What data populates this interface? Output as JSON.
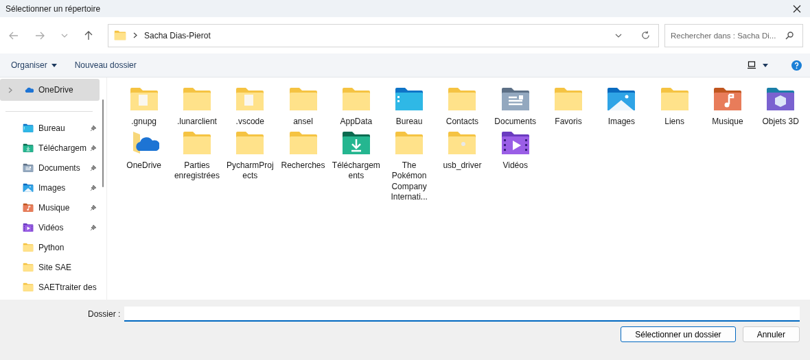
{
  "window": {
    "title": "Sélectionner un répertoire"
  },
  "address_bar": {
    "path": [
      "Sacha Dias-Pierot"
    ]
  },
  "search": {
    "placeholder": "Rechercher dans : Sacha Di..."
  },
  "toolbar": {
    "organize": "Organiser",
    "new_folder": "Nouveau dossier"
  },
  "sidebar": {
    "items": [
      {
        "label": "OneDrive",
        "kind": "onedrive",
        "selected": true,
        "pinned": false,
        "expandable": true
      },
      {
        "label": "Bureau",
        "kind": "desktop",
        "selected": false,
        "pinned": true,
        "expandable": false
      },
      {
        "label": "Téléchargem",
        "kind": "download",
        "selected": false,
        "pinned": true,
        "expandable": false
      },
      {
        "label": "Documents",
        "kind": "documents",
        "selected": false,
        "pinned": true,
        "expandable": false
      },
      {
        "label": "Images",
        "kind": "images",
        "selected": false,
        "pinned": true,
        "expandable": false
      },
      {
        "label": "Musique",
        "kind": "music",
        "selected": false,
        "pinned": true,
        "expandable": false
      },
      {
        "label": "Vidéos",
        "kind": "videos",
        "selected": false,
        "pinned": true,
        "expandable": false
      },
      {
        "label": "Python",
        "kind": "folder",
        "selected": false,
        "pinned": false,
        "expandable": false
      },
      {
        "label": "Site SAE",
        "kind": "folder",
        "selected": false,
        "pinned": false,
        "expandable": false
      },
      {
        "label": "SAETtraiter des",
        "kind": "folder",
        "selected": false,
        "pinned": false,
        "expandable": false
      }
    ]
  },
  "folders": [
    {
      "name": ".gnupg",
      "kind": "files"
    },
    {
      "name": ".lunarclient",
      "kind": "folder"
    },
    {
      "name": ".vscode",
      "kind": "files"
    },
    {
      "name": "ansel",
      "kind": "folder"
    },
    {
      "name": "AppData",
      "kind": "folder"
    },
    {
      "name": "Bureau",
      "kind": "desktop"
    },
    {
      "name": "Contacts",
      "kind": "folder"
    },
    {
      "name": "Documents",
      "kind": "documents"
    },
    {
      "name": "Favoris",
      "kind": "folder"
    },
    {
      "name": "Images",
      "kind": "images"
    },
    {
      "name": "Liens",
      "kind": "folder"
    },
    {
      "name": "Musique",
      "kind": "music"
    },
    {
      "name": "Objets 3D",
      "kind": "objects3d"
    },
    {
      "name": "OneDrive",
      "kind": "onedrive"
    },
    {
      "name": "Parties enregistrées",
      "kind": "folder"
    },
    {
      "name": "PycharmProjects",
      "kind": "folder"
    },
    {
      "name": "Recherches",
      "kind": "folder"
    },
    {
      "name": "Téléchargements",
      "kind": "download"
    },
    {
      "name": "The Pokémon Company Internati...",
      "kind": "folder"
    },
    {
      "name": "usb_driver",
      "kind": "usb"
    },
    {
      "name": "Vidéos",
      "kind": "videos"
    }
  ],
  "footer": {
    "field_label": "Dossier :",
    "buttons": [
      "Sélectionner un dossier",
      "Annuler"
    ]
  }
}
